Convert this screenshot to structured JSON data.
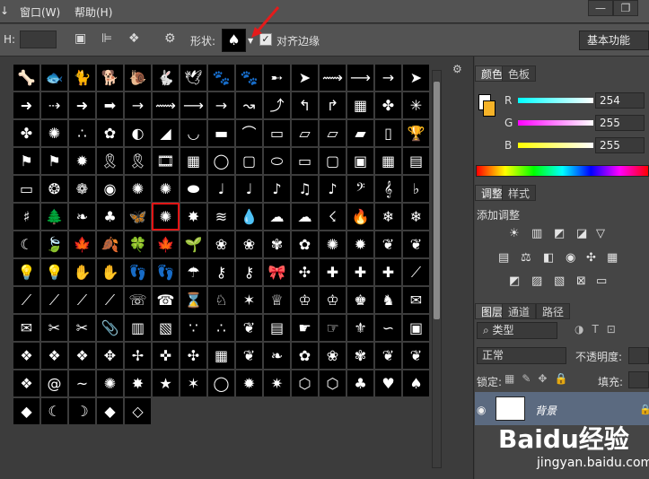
{
  "menubar": {
    "window": "窗口(W)",
    "help": "帮助(H)",
    "minimize": "—",
    "restore": "❐"
  },
  "options": {
    "h_label": "H:",
    "shape_label": "形状:",
    "align_label": "对齐边缘",
    "align_checked": true,
    "workspace": "基本功能",
    "shape_glyph": "♠"
  },
  "picker": {
    "shapes": [
      "🦴",
      "🐟",
      "🐈",
      "🐕",
      "🐌",
      "🐇",
      "🕊",
      "🐾",
      "🐾",
      "➸",
      "➤",
      "⟿",
      "⟶",
      "→",
      "➤",
      "➜",
      "⇢",
      "➜",
      "➡",
      "→",
      "⟿",
      "⟶",
      "→",
      "↝",
      "⤴",
      "↰",
      "↱",
      "▦",
      "✤",
      "✳",
      "✤",
      "✺",
      "∴",
      "✿",
      "◐",
      "◢",
      "◡",
      "▬",
      "⌒",
      "▭",
      "▱",
      "▱",
      "▰",
      "▯",
      "🏆",
      "⚑",
      "⚑",
      "✹",
      "🎗",
      "🎗",
      "🎞",
      "▦",
      "◯",
      "▢",
      "⬭",
      "▭",
      "▢",
      "▣",
      "▦",
      "▤",
      "▭",
      "❂",
      "❁",
      "◉",
      "✺",
      "✺",
      "⬬",
      "♩",
      "♩",
      "♪",
      "♫",
      "♪",
      "𝄢",
      "𝄞",
      "♭",
      "♯",
      "🌲",
      "❧",
      "♣",
      "🦋",
      "✺",
      "✸",
      "≋",
      "💧",
      "☁",
      "☁",
      "☇",
      "🔥",
      "❄",
      "❄",
      "☾",
      "🍃",
      "🍁",
      "🍂",
      "🍀",
      "🍁",
      "🌱",
      "❀",
      "❀",
      "✾",
      "✿",
      "✺",
      "✹",
      "❦",
      "❦",
      "💡",
      "💡",
      "✋",
      "✋",
      "👣",
      "👣",
      "☂",
      "⚷",
      "⚷",
      "🎀",
      "✣",
      "✚",
      "✚",
      "✚",
      "⟋",
      "⟋",
      "⟋",
      "⟋",
      "⟋",
      "☏",
      "☎",
      "⌛",
      "♘",
      "✶",
      "♕",
      "♔",
      "♔",
      "♚",
      "♞",
      "✉",
      "✉",
      "✂",
      "✂",
      "📎",
      "▥",
      "▧",
      "∵",
      "∴",
      "❦",
      "▤",
      "☛",
      "☞",
      "⚜",
      "∽",
      "▣",
      "❖",
      "❖",
      "❖",
      "✥",
      "✢",
      "✜",
      "✣",
      "▦",
      "❦",
      "❧",
      "✿",
      "❀",
      "✾",
      "❦",
      "❦",
      "❖",
      "@",
      "~",
      "✺",
      "✸",
      "★",
      "✶",
      "◯",
      "✹",
      "✷",
      "⬡",
      "⬡",
      "♣",
      "♥",
      "♠",
      "◆",
      "☾",
      "☽",
      "◆",
      "◇"
    ],
    "selected_index": 80,
    "gear": "⚙"
  },
  "panel": {
    "tab_color": "颜色",
    "tab_swatches": "色板",
    "r_label": "R",
    "g_label": "G",
    "b_label": "B",
    "r": "254",
    "g": "255",
    "b": "255",
    "tab_adjust": "调整",
    "tab_styles": "样式",
    "adjust_hint": "添加调整",
    "tab_layers": "图层",
    "tab_channels": "通道",
    "tab_paths": "路径",
    "kind_label": "类型",
    "blend": "正常",
    "opacity_label": "不透明度:",
    "lock_label": "锁定:",
    "fill_label": "填充:",
    "layer_name": "背景"
  },
  "watermark": {
    "brand": "Baidu经验",
    "url": "jingyan.baidu.com"
  }
}
